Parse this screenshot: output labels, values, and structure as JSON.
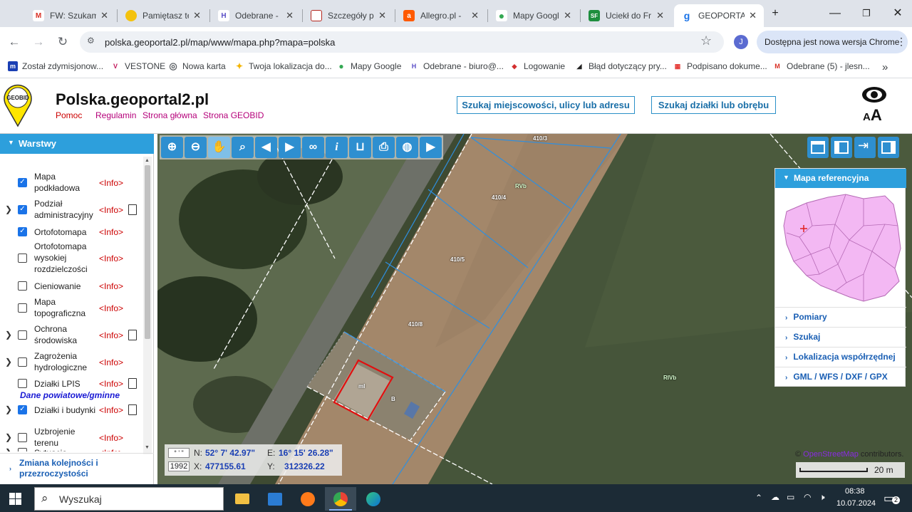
{
  "browser": {
    "tabs": [
      {
        "title": "FW: Szukam",
        "color": "#d93025",
        "glyph": "M"
      },
      {
        "title": "Pamiętasz te",
        "color": "#f4c20d",
        "glyph": ""
      },
      {
        "title": "Odebrane - ",
        "color": "#5b4fc7",
        "glyph": "H"
      },
      {
        "title": "Szczegóły p",
        "color": "#b3261e",
        "glyph": "▯"
      },
      {
        "title": "Allegro.pl - ",
        "color": "#ff5a00",
        "glyph": "a"
      },
      {
        "title": "Mapy Googl",
        "color": "#34a853",
        "glyph": "⬤"
      },
      {
        "title": "Uciekł do Fr",
        "color": "#1e8e3e",
        "glyph": "SF"
      },
      {
        "title": "GEOPORTAL",
        "color": "#1a73e8",
        "glyph": "g"
      }
    ],
    "new_tab_label": "+",
    "url": "polska.geoportal2.pl/map/www/mapa.php?mapa=polska",
    "update_button": "Dostępna jest nowa wersja Chrome",
    "profile_initial": "J",
    "bookmarks": [
      {
        "label": "Został zdymisjonow...",
        "color": "#1a3fb4",
        "glyph": "m"
      },
      {
        "label": "VESTONE",
        "color": "#c2185b",
        "glyph": "V"
      },
      {
        "label": "Nowa karta",
        "color": "#5f6368",
        "glyph": "◎"
      },
      {
        "label": "Twoja lokalizacja do...",
        "color": "#f4b400",
        "glyph": "✦"
      },
      {
        "label": "Mapy Google",
        "color": "#34a853",
        "glyph": "⬤"
      },
      {
        "label": "Odebrane - biuro@...",
        "color": "#5b4fc7",
        "glyph": "H"
      },
      {
        "label": "Logowanie",
        "color": "#d32f2f",
        "glyph": "◆"
      },
      {
        "label": "Błąd dotyczący pry...",
        "color": "#222222",
        "glyph": "◢"
      },
      {
        "label": "Podpisano dokume...",
        "color": "#e53935",
        "glyph": "▦"
      },
      {
        "label": "Odebrane (5) - jlesn...",
        "color": "#d93025",
        "glyph": "M"
      }
    ],
    "bookmarks_more": "»"
  },
  "site": {
    "logo_text": "GEOBID",
    "title": "Polska.geoportal2.pl",
    "links": [
      "Pomoc",
      "Regulamin",
      "Strona główna",
      "Strona GEOBID"
    ],
    "search_place_btn": "Szukaj miejscowości, ulicy lub adresu",
    "search_parcel_btn": "Szukaj działki lub obrębu",
    "font_size_icon": "AA"
  },
  "layers_panel": {
    "title": "Warstwy",
    "items": [
      {
        "name": "Mapa podkładowa",
        "checked": true,
        "expandable": false,
        "doc": false
      },
      {
        "name": "Podział administracyjny",
        "checked": true,
        "expandable": true,
        "doc": true
      },
      {
        "name": "Ortofotomapa",
        "checked": true,
        "expandable": false,
        "doc": false
      },
      {
        "name": "Ortofotomapa wysokiej rozdzielczości",
        "checked": false,
        "expandable": false,
        "doc": false
      },
      {
        "name": "Cieniowanie",
        "checked": false,
        "expandable": false,
        "doc": false
      },
      {
        "name": "Mapa topograficzna",
        "checked": false,
        "expandable": false,
        "doc": false
      },
      {
        "name": "Ochrona środowiska",
        "checked": false,
        "expandable": true,
        "doc": true
      },
      {
        "name": "Zagrożenia hydrologiczne",
        "checked": false,
        "expandable": true,
        "doc": false
      },
      {
        "name": "Działki LPIS",
        "checked": false,
        "expandable": false,
        "doc": true
      },
      {
        "name": "Działki i budynki",
        "checked": true,
        "expandable": true,
        "doc": true
      },
      {
        "name": "Uzbrojenie terenu",
        "checked": false,
        "expandable": true,
        "doc": false
      },
      {
        "name": "Sytuacja",
        "checked": false,
        "expandable": true,
        "doc": false
      }
    ],
    "info_label": "<Info>",
    "section_label": "Dane powiatowe/gminne",
    "footer": "Zmiana kolejności i przezroczystości"
  },
  "map": {
    "parcel_labels": [
      "410/3",
      "410/4",
      "410/5",
      "410/8",
      "RVb",
      "RIVb",
      "mI",
      "B"
    ],
    "reference_map": {
      "title": "Mapa referencyjna",
      "items": [
        "Pomiary",
        "Szukaj",
        "Lokalizacja współrzędnej",
        "GML / WFS / DXF / GPX"
      ]
    },
    "coords": {
      "deg_label": "° ' \"",
      "sys_label": "1992",
      "n_label": "N:",
      "n_value": "52° 7' 42.97\"",
      "e_label": "E:",
      "e_value": "16° 15' 26.28\"",
      "x_label": "X:",
      "x_value": "477155.61",
      "y_label": "Y:",
      "y_value": "312326.22"
    },
    "attribution_prefix": "©",
    "attribution_link": "OpenStreetMap",
    "attribution_suffix": "contributors.",
    "scale_label": "20 m"
  },
  "taskbar": {
    "search_placeholder": "Wyszukaj",
    "time": "08:38",
    "date": "10.07.2024",
    "notifications": "2"
  }
}
